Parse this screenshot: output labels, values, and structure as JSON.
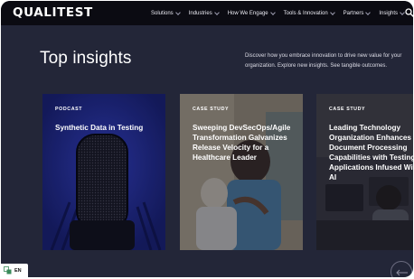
{
  "nav": {
    "logo": "QUALITEST",
    "items": [
      {
        "label": "Solutions"
      },
      {
        "label": "Industries"
      },
      {
        "label": "How We Engage"
      },
      {
        "label": "Tools & Innovation"
      },
      {
        "label": "Partners"
      },
      {
        "label": "Insights"
      }
    ],
    "search_icon": "search-icon"
  },
  "section": {
    "title": "Top insights",
    "intro": "Discover how you embrace innovation to drive new value for your organization. Explore new insights. See tangible outcomes."
  },
  "cards": [
    {
      "type": "PODCAST",
      "title": "Synthetic Data in Testing"
    },
    {
      "type": "CASE STUDY",
      "title": "Sweeping DevSecOps/Agile Transformation Galvanizes Release Velocity for a Healthcare Leader"
    },
    {
      "type": "CASE STUDY",
      "title": "Leading Technology Organization Enhances Document Processing Capabilities with Testing Applications Infused With AI"
    }
  ],
  "footer": {
    "language": "EN",
    "language_icon": "translate-icon",
    "prev_icon": "arrow-left-icon"
  },
  "colors": {
    "background": "#232638",
    "nav": "#0b0b12",
    "podcast_card": "#1b2270"
  }
}
